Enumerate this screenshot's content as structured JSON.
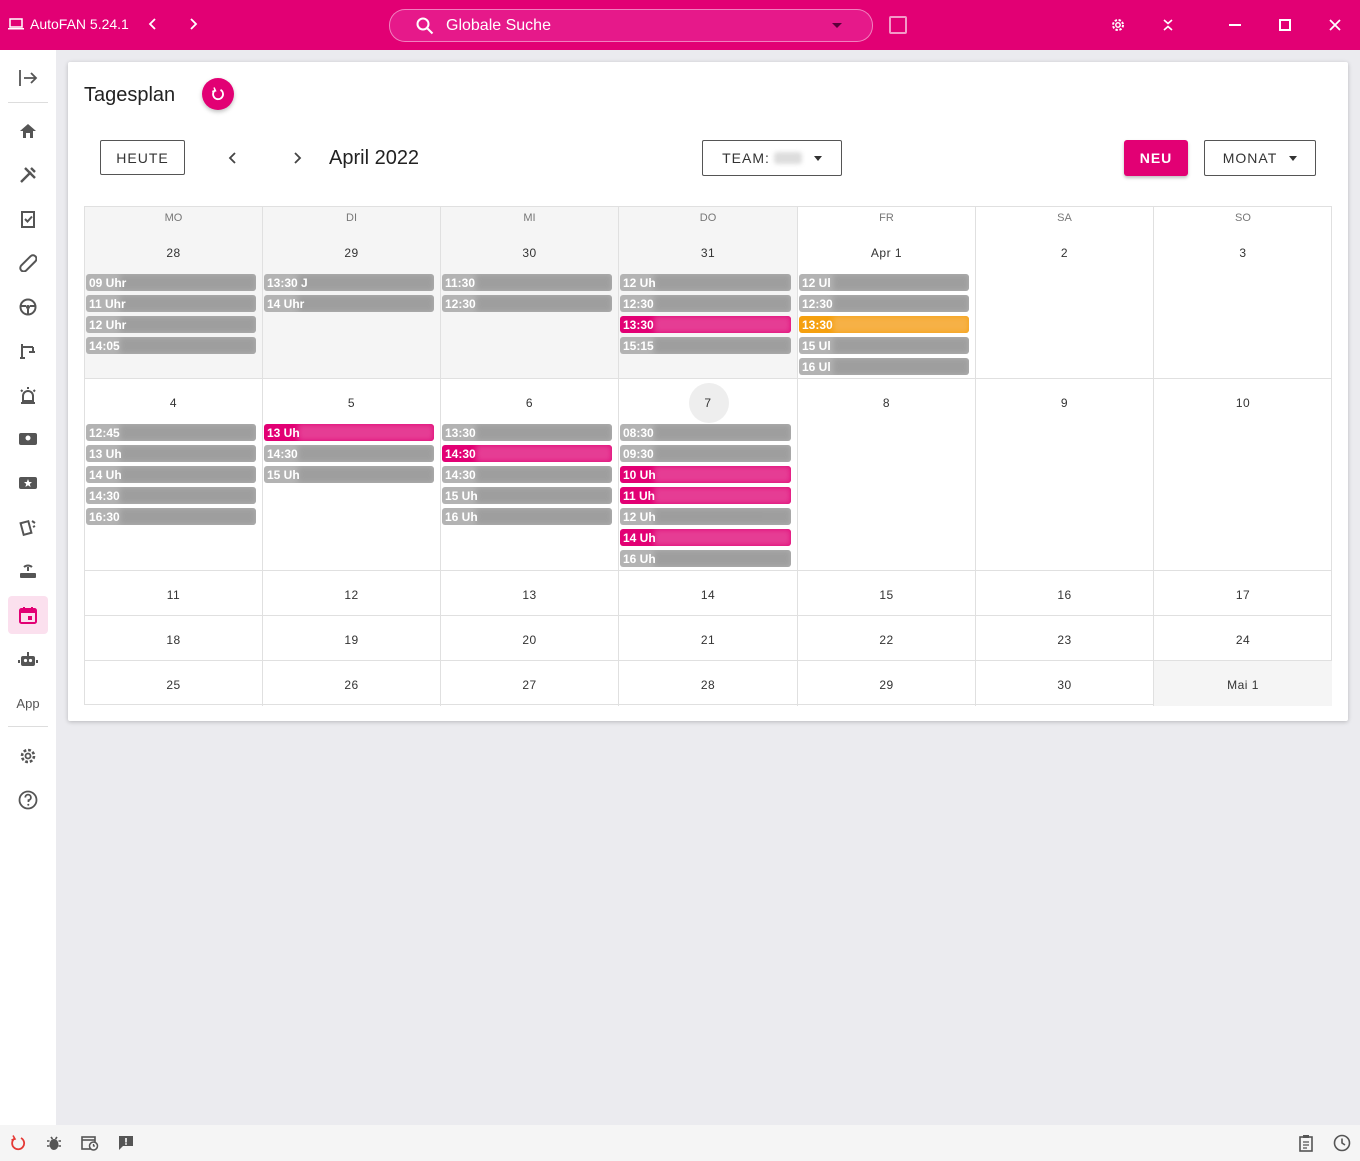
{
  "app": {
    "title": "AutoFAN 5.24.1"
  },
  "search": {
    "placeholder": "Globale Suche"
  },
  "sidebar": {
    "app_label": "App"
  },
  "page": {
    "title": "Tagesplan",
    "today_button": "HEUTE",
    "month_label": "April 2022",
    "team_label": "TEAM:",
    "new_button": "NEU",
    "view_button": "MONAT"
  },
  "calendar": {
    "weekdays": [
      "MO",
      "DI",
      "MI",
      "DO",
      "FR",
      "SA",
      "SO"
    ],
    "weeks": [
      [
        "28",
        "29",
        "30",
        "31",
        "Apr 1",
        "2",
        "3"
      ],
      [
        "4",
        "5",
        "6",
        "7",
        "8",
        "9",
        "10"
      ],
      [
        "11",
        "12",
        "13",
        "14",
        "15",
        "16",
        "17"
      ],
      [
        "18",
        "19",
        "20",
        "21",
        "22",
        "23",
        "24"
      ],
      [
        "25",
        "26",
        "27",
        "28",
        "29",
        "30",
        "Mai 1"
      ]
    ],
    "events": {
      "w0d0": [
        {
          "t": "09 Uhr",
          "c": "gray"
        },
        {
          "t": "11 Uhr",
          "c": "gray"
        },
        {
          "t": "12 Uhr",
          "c": "gray"
        },
        {
          "t": "14:05",
          "c": "gray"
        }
      ],
      "w0d1": [
        {
          "t": "13:30 J",
          "c": "gray"
        },
        {
          "t": "14 Uhr",
          "c": "gray"
        }
      ],
      "w0d2": [
        {
          "t": "11:30",
          "c": "gray"
        },
        {
          "t": "12:30",
          "c": "gray"
        }
      ],
      "w0d3": [
        {
          "t": "12 Uh",
          "c": "gray"
        },
        {
          "t": "12:30",
          "c": "gray"
        },
        {
          "t": "13:30",
          "c": "pink"
        },
        {
          "t": "15:15",
          "c": "gray"
        }
      ],
      "w0d4": [
        {
          "t": "12 Ul",
          "c": "gray"
        },
        {
          "t": "12:30",
          "c": "gray"
        },
        {
          "t": "13:30",
          "c": "orange"
        },
        {
          "t": "15 Ul",
          "c": "gray"
        },
        {
          "t": "16 Ul",
          "c": "gray"
        }
      ],
      "w1d0": [
        {
          "t": "12:45",
          "c": "gray"
        },
        {
          "t": "13 Uh",
          "c": "gray"
        },
        {
          "t": "14 Uh",
          "c": "gray"
        },
        {
          "t": "14:30",
          "c": "gray"
        },
        {
          "t": "16:30",
          "c": "gray"
        }
      ],
      "w1d1": [
        {
          "t": "13 Uh",
          "c": "pink"
        },
        {
          "t": "14:30",
          "c": "gray"
        },
        {
          "t": "15 Uh",
          "c": "gray"
        }
      ],
      "w1d2": [
        {
          "t": "13:30",
          "c": "gray"
        },
        {
          "t": "14:30",
          "c": "pink"
        },
        {
          "t": "14:30",
          "c": "gray"
        },
        {
          "t": "15 Uh",
          "c": "gray"
        },
        {
          "t": "16 Uh",
          "c": "gray"
        }
      ],
      "w1d3": [
        {
          "t": "08:30",
          "c": "gray"
        },
        {
          "t": "09:30",
          "c": "gray"
        },
        {
          "t": "10 Uh",
          "c": "pink"
        },
        {
          "t": "11 Uh",
          "c": "pink"
        },
        {
          "t": "12 Uh",
          "c": "gray"
        },
        {
          "t": "14 Uh",
          "c": "pink"
        },
        {
          "t": "16 Uh",
          "c": "gray"
        }
      ]
    }
  },
  "colors": {
    "accent": "#e20074",
    "orange": "#f5a00f",
    "event_gray": "#b3b3b3"
  }
}
